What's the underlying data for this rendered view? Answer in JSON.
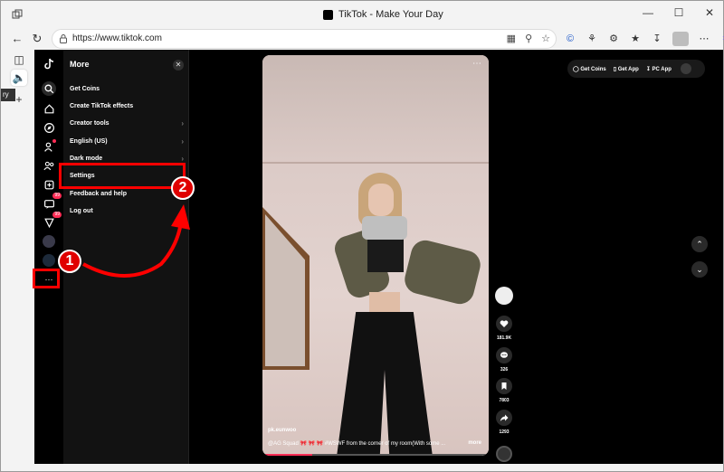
{
  "window": {
    "title": "TikTok - Make Your Day"
  },
  "browser": {
    "url": "https://www.tiktok.com"
  },
  "more_panel": {
    "title": "More",
    "items": [
      {
        "label": "Get Coins",
        "has_chevron": false
      },
      {
        "label": "Create TikTok effects",
        "has_chevron": false
      },
      {
        "label": "Creator tools",
        "has_chevron": true
      },
      {
        "label": "English (US)",
        "has_chevron": true
      },
      {
        "label": "Dark mode",
        "has_chevron": true
      },
      {
        "label": "Settings",
        "has_chevron": false
      },
      {
        "label": "Feedback and help",
        "has_chevron": false
      },
      {
        "label": "Log out",
        "has_chevron": false
      }
    ]
  },
  "rail": {
    "inbox_badge": "99",
    "activity_badge": "99"
  },
  "top_actions": {
    "get_coins": "Get Coins",
    "get_app": "Get App",
    "pc_app": "PC App"
  },
  "video": {
    "username": "pk.eunwoo",
    "caption": "@AG Squad  🎀 🎀 🎀  #WSWF  from the corner of my room(With some ...",
    "more_label": "more",
    "progress_fraction": 0.22
  },
  "video_actions": {
    "likes": "181.9K",
    "comments": "326",
    "saves": "7803",
    "shares": "1293"
  },
  "annotations": {
    "step1": "1",
    "step2": "2"
  },
  "colors": {
    "annotation_red": "#ff0000",
    "tiktok_pink": "#fe2c55",
    "panel_bg": "#121212"
  }
}
